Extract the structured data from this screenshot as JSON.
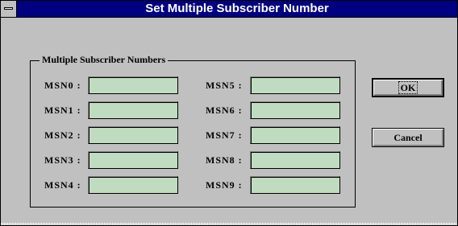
{
  "window": {
    "title": "Set Multiple Subscriber Number"
  },
  "group": {
    "label": "Multiple Subscriber Numbers"
  },
  "msn_left": [
    {
      "label": "MSN0 :",
      "value": ""
    },
    {
      "label": "MSN1 :",
      "value": ""
    },
    {
      "label": "MSN2 :",
      "value": ""
    },
    {
      "label": "MSN3 :",
      "value": ""
    },
    {
      "label": "MSN4 :",
      "value": ""
    }
  ],
  "msn_right": [
    {
      "label": "MSN5 :",
      "value": ""
    },
    {
      "label": "MSN6 :",
      "value": ""
    },
    {
      "label": "MSN7 :",
      "value": ""
    },
    {
      "label": "MSN8 :",
      "value": ""
    },
    {
      "label": "MSN9 :",
      "value": ""
    }
  ],
  "buttons": {
    "ok": "OK",
    "cancel": "Cancel"
  },
  "colors": {
    "titlebar": "#000080",
    "field": "#c0dcc0",
    "face": "#c0c0c0"
  }
}
